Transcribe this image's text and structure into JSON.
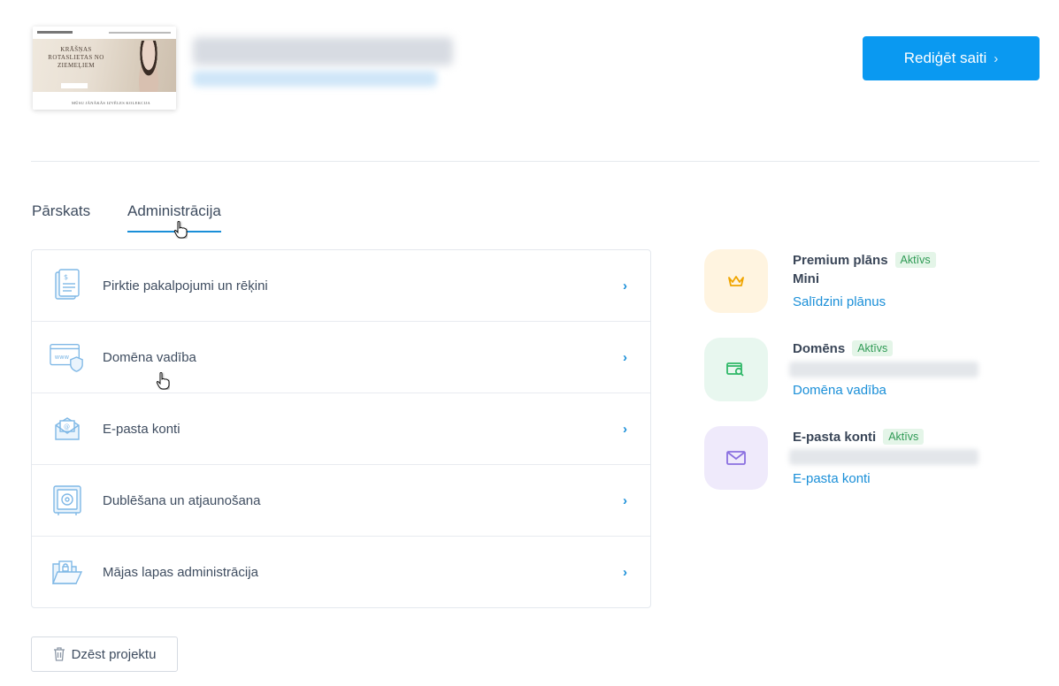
{
  "header": {
    "thumbnail": {
      "hero_text_1": "KRĀŠŅAS",
      "hero_text_2": "ROTASLIETAS NO",
      "hero_text_3": "ZIEMEĻIEM",
      "footer_text": "MŪSU JĀNĀKĀS IZVĒLES KOLEKCIJA"
    },
    "edit_button_label": "Rediģēt saiti",
    "edit_button_chevron": "›"
  },
  "tabs": [
    {
      "label": "Pārskats",
      "active": false
    },
    {
      "label": "Administrācija",
      "active": true
    }
  ],
  "admin_menu": [
    {
      "label": "Pirktie pakalpojumi un rēķini",
      "icon": "invoice-icon"
    },
    {
      "label": "Domēna vadība",
      "icon": "domain-www-icon"
    },
    {
      "label": "E-pasta konti",
      "icon": "email-envelope-icon"
    },
    {
      "label": "Dublēšana un atjaunošana",
      "icon": "safe-backup-icon"
    },
    {
      "label": "Mājas lapas administrācija",
      "icon": "folder-lock-icon"
    }
  ],
  "menu_arrow": "›",
  "services": [
    {
      "title": "Premium plāns",
      "badge": "Aktīvs",
      "subtitle": "Mini",
      "link": "Salīdzini plānus",
      "icon": "crown-icon",
      "bg": "#fff4e0",
      "icon_color": "#f0a500"
    },
    {
      "title": "Domēns",
      "badge": "Aktīvs",
      "subtitle": "",
      "link": "Domēna vadība",
      "icon": "domain-search-icon",
      "bg": "#e8f7ef",
      "icon_color": "#2fb868"
    },
    {
      "title": "E-pasta konti",
      "badge": "Aktīvs",
      "subtitle": "",
      "link": "E-pasta konti",
      "icon": "mail-icon",
      "bg": "#efeafb",
      "icon_color": "#8a6fe0"
    }
  ],
  "delete_button_label": "Dzēst projektu",
  "colors": {
    "accent": "#0a99f1",
    "link": "#1a8fd8",
    "badge_bg": "#e4f5e8",
    "badge_text": "#2f9a55"
  }
}
